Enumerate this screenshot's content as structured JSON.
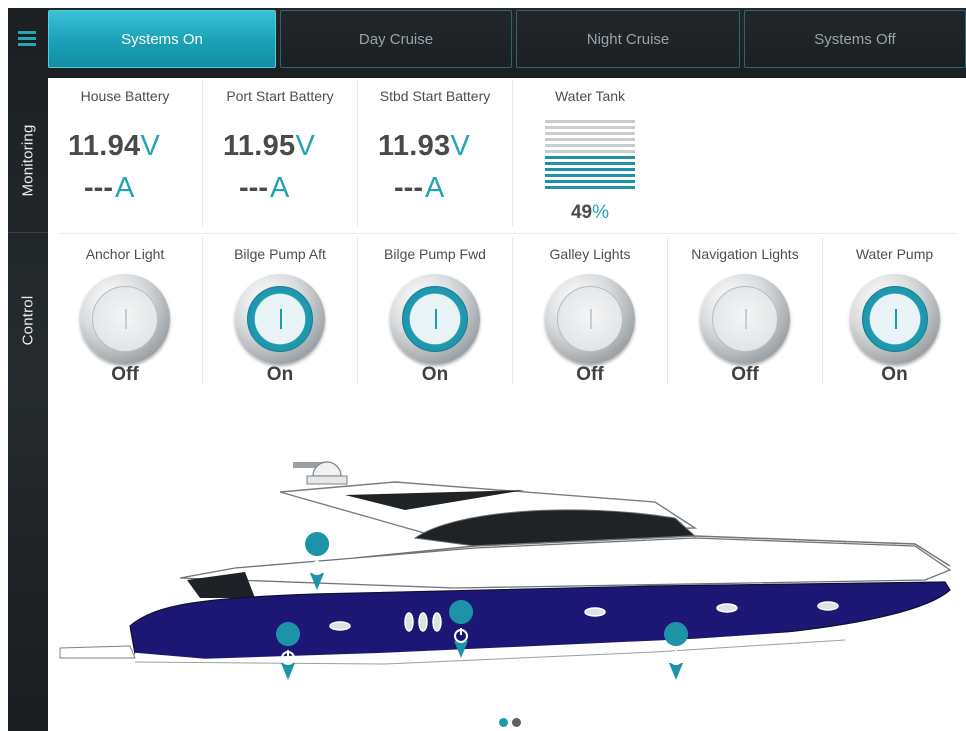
{
  "nav": {
    "menu_icon": "hamburger-menu-icon",
    "side_tabs": [
      {
        "label": "Monitoring"
      },
      {
        "label": "Control"
      }
    ],
    "modes": [
      {
        "label": "Systems On",
        "active": true
      },
      {
        "label": "Day Cruise",
        "active": false
      },
      {
        "label": "Night Cruise",
        "active": false
      },
      {
        "label": "Systems Off",
        "active": false
      }
    ]
  },
  "monitoring": {
    "batteries": [
      {
        "title": "House Battery",
        "volts": "11.94",
        "volt_unit": "V",
        "amps": "---",
        "amp_unit": "A"
      },
      {
        "title": "Port Start Battery",
        "volts": "11.95",
        "volt_unit": "V",
        "amps": "---",
        "amp_unit": "A"
      },
      {
        "title": "Stbd Start Battery",
        "volts": "11.93",
        "volt_unit": "V",
        "amps": "---",
        "amp_unit": "A"
      }
    ],
    "water_tank": {
      "title": "Water Tank",
      "level": 49,
      "level_text": "49",
      "unit": "%"
    }
  },
  "controls": [
    {
      "title": "Anchor Light",
      "state": "Off",
      "on": false
    },
    {
      "title": "Bilge Pump Aft",
      "state": "On",
      "on": true
    },
    {
      "title": "Bilge Pump Fwd",
      "state": "On",
      "on": true
    },
    {
      "title": "Galley Lights",
      "state": "Off",
      "on": false
    },
    {
      "title": "Navigation Lights",
      "state": "Off",
      "on": false
    },
    {
      "title": "Water Pump",
      "state": "On",
      "on": true
    }
  ],
  "colors": {
    "accent": "#1e9ab0",
    "hull": "#1c1775",
    "dark": "#1b1f22"
  },
  "pager": {
    "pages": 2,
    "current": 1
  }
}
